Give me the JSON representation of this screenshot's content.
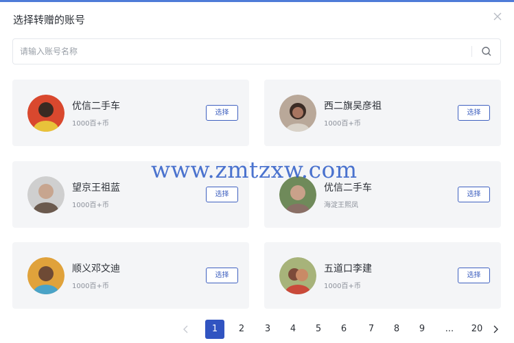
{
  "dialog": {
    "title": "选择转赠的账号",
    "accent": "#4f7bd8"
  },
  "search": {
    "placeholder": "请输入账号名称",
    "value": ""
  },
  "select_label": "选择",
  "accounts": [
    {
      "name": "优信二手车",
      "sub": "1000百+币",
      "avatar_colors": [
        "#d9482e",
        "#3a2a22"
      ]
    },
    {
      "name": "西二旗吴彦祖",
      "sub": "1000百+币",
      "avatar_colors": [
        "#b9a899",
        "#3b2c25"
      ]
    },
    {
      "name": "望京王祖蓝",
      "sub": "1000百+币",
      "avatar_colors": [
        "#c9c9c9",
        "#6b5a4e"
      ]
    },
    {
      "name": "优信二手车",
      "sub": "海淀王熙凤",
      "avatar_colors": [
        "#6f8a5a",
        "#c9a18a"
      ]
    },
    {
      "name": "顺义邓文迪",
      "sub": "1000百+币",
      "avatar_colors": [
        "#e0a23b",
        "#4a3326"
      ]
    },
    {
      "name": "五道口李建",
      "sub": "1000百+币",
      "avatar_colors": [
        "#a7b37a",
        "#7d4a3a"
      ]
    }
  ],
  "watermark": "www.zmtzxw.com",
  "pagination": {
    "current": "1",
    "pages": [
      "1",
      "2",
      "3",
      "4",
      "5",
      "6",
      "7",
      "8",
      "9",
      "...",
      "20"
    ],
    "active_color": "#3154c1"
  }
}
